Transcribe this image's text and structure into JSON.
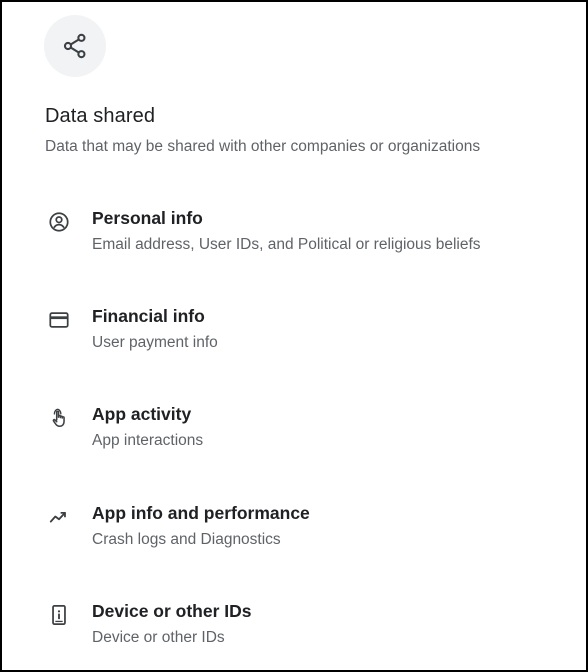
{
  "header": {
    "icon": "share-icon",
    "title": "Data shared",
    "subtitle": "Data that may be shared with other companies or organizations"
  },
  "items": [
    {
      "icon": "account-circle-icon",
      "title": "Personal info",
      "description": "Email address, User IDs, and Political or religious beliefs"
    },
    {
      "icon": "credit-card-icon",
      "title": "Financial info",
      "description": "User payment info"
    },
    {
      "icon": "touch-hand-icon",
      "title": "App activity",
      "description": "App interactions"
    },
    {
      "icon": "performance-trend-icon",
      "title": "App info and performance",
      "description": "Crash logs and Diagnostics"
    },
    {
      "icon": "device-info-icon",
      "title": "Device or other IDs",
      "description": "Device or other IDs"
    }
  ],
  "colors": {
    "title": "#202124",
    "secondary_text": "#5f6368",
    "icon": "#3c4043",
    "icon_circle_bg": "#f1f3f4",
    "border": "#000000"
  }
}
